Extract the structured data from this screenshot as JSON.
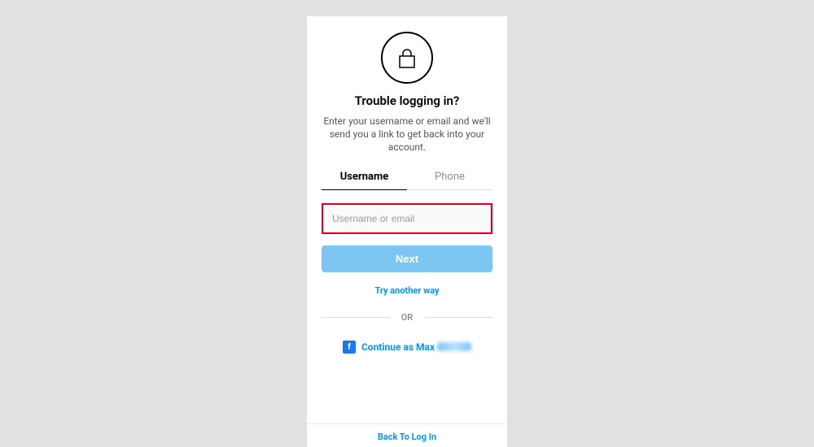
{
  "title": "Trouble logging in?",
  "description": "Enter your username or email and we'll send you a link to get back into your account.",
  "tabs": {
    "username": "Username",
    "phone": "Phone"
  },
  "input": {
    "placeholder": "Username or email",
    "value": ""
  },
  "next_label": "Next",
  "try_another": "Try another way",
  "or_label": "OR",
  "facebook": {
    "prefix": "Continue as Max"
  },
  "back_label": "Back To Log In"
}
